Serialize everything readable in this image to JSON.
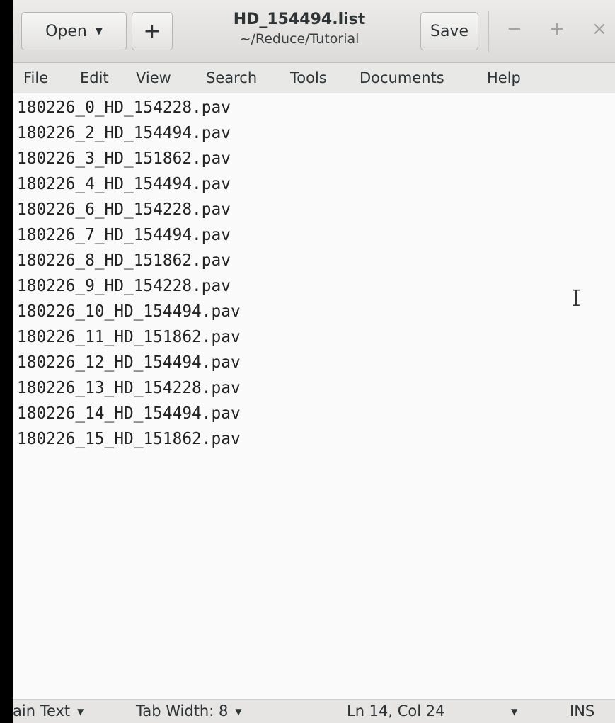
{
  "window": {
    "title": "HD_154494.list",
    "subtitle": "~/Reduce/Tutorial"
  },
  "header": {
    "open_label": "Open",
    "open_dropdown_icon": "chevron-down-icon",
    "new_label": "+",
    "save_label": "Save",
    "minimize_label": "−",
    "maximize_label": "+",
    "close_label": "×"
  },
  "menu": [
    "File",
    "Edit",
    "View",
    "Search",
    "Tools",
    "Documents",
    "Help"
  ],
  "editor": {
    "lines": [
      "180226_0_HD_154228.pav",
      "180226_2_HD_154494.pav",
      "180226_3_HD_151862.pav",
      "180226_4_HD_154494.pav",
      "180226_6_HD_154228.pav",
      "180226_7_HD_154494.pav",
      "180226_8_HD_151862.pav",
      "180226_9_HD_154228.pav",
      "180226_10_HD_154494.pav",
      "180226_11_HD_151862.pav",
      "180226_12_HD_154494.pav",
      "180226_13_HD_154228.pav",
      "180226_14_HD_154494.pav",
      "180226_15_HD_151862.pav"
    ],
    "cursor_icon": "i-beam-cursor-icon"
  },
  "status": {
    "language": "ain Text",
    "tab_width": "Tab Width: 8",
    "position": "Ln 14, Col 24",
    "mode": "INS"
  }
}
